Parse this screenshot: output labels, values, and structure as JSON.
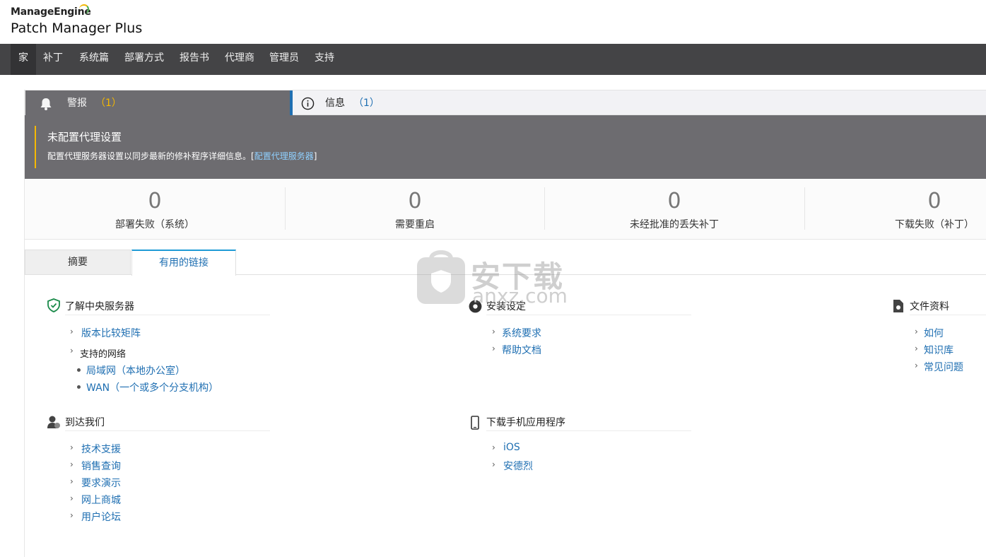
{
  "brand": {
    "top": "ManageEngine",
    "main": "Patch Manager Plus"
  },
  "nav": [
    "家",
    "补丁",
    "系统篇",
    "部署方式",
    "报告书",
    "代理商",
    "管理员",
    "支持"
  ],
  "alert_tabs": {
    "alarm_label": "警报",
    "alarm_count": "（1）",
    "info_label": "信息",
    "info_count": "（1）"
  },
  "alert": {
    "title": "未配置代理设置",
    "message": "配置代理服务器设置以同步最新的修补程序详细信息。[",
    "link": "配置代理服务器",
    "close_bracket": "]"
  },
  "stats": [
    {
      "value": "0",
      "label": "部署失败（系统）"
    },
    {
      "value": "0",
      "label": "需要重启"
    },
    {
      "value": "0",
      "label": "未经批准的丢失补丁"
    },
    {
      "value": "0",
      "label": "下载失败（补丁）"
    }
  ],
  "subtabs": {
    "summary": "摘要",
    "links": "有用的链接"
  },
  "sections": {
    "learn": {
      "title": "了解中央服务器",
      "item1": "版本比较矩阵",
      "item2": "支持的网络",
      "sub1": "局域网（本地办公室）",
      "sub2": "WAN（一个或多个分支机构）"
    },
    "install": {
      "title": "安装设定",
      "item1": "系统要求",
      "item2": "帮助文档"
    },
    "docs": {
      "title": "文件资料",
      "item1": "如何",
      "item2": "知识库",
      "item3": "常见问题"
    },
    "reach": {
      "title": "到达我们",
      "items": [
        "技术支援",
        "销售查询",
        "要求演示",
        "网上商城",
        "用户论坛"
      ]
    },
    "mobile": {
      "title": "下载手机应用程序",
      "item1": "iOS",
      "item2": "安德烈"
    }
  },
  "watermark": {
    "cn": "安下载",
    "en": "anxz.com"
  },
  "colors": {
    "nav_bg": "#444446",
    "alert_bg": "#6d6c70",
    "link": "#1f6fb2",
    "accent": "#f5b800"
  }
}
